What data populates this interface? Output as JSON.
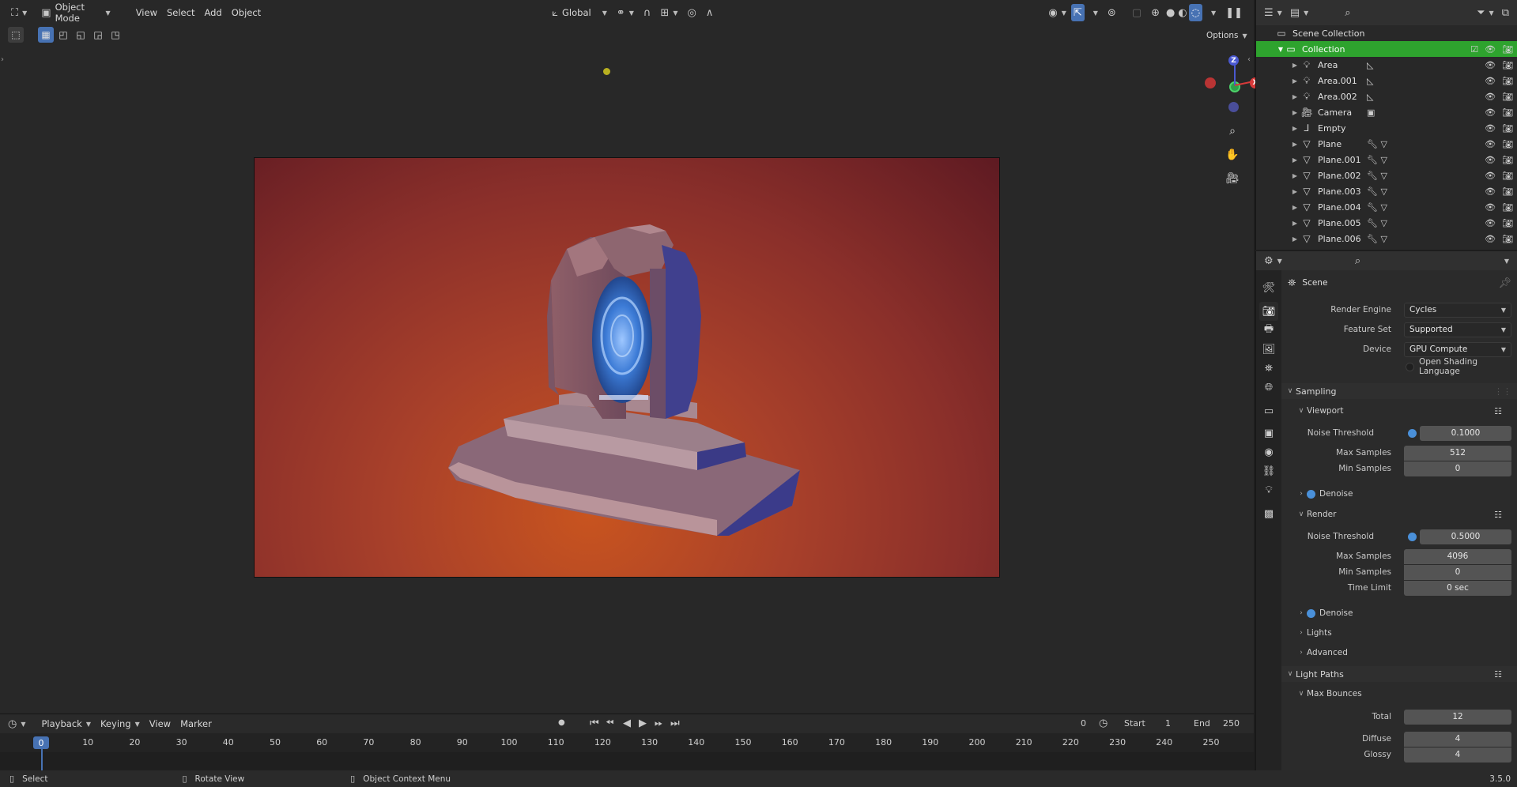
{
  "viewport": {
    "mode_label": "Object Mode",
    "menus": [
      "View",
      "Select",
      "Add",
      "Object"
    ],
    "transform_orientation": "Global",
    "options_label": "Options",
    "gizmo": {
      "z": "Z",
      "x": "X",
      "y": "Y"
    }
  },
  "outliner": {
    "scene_collection": "Scene Collection",
    "collection": "Collection",
    "items": [
      {
        "name": "Area",
        "type": "light"
      },
      {
        "name": "Area.001",
        "type": "light"
      },
      {
        "name": "Area.002",
        "type": "light"
      },
      {
        "name": "Camera",
        "type": "camera"
      },
      {
        "name": "Empty",
        "type": "empty"
      },
      {
        "name": "Plane",
        "type": "mesh"
      },
      {
        "name": "Plane.001",
        "type": "mesh"
      },
      {
        "name": "Plane.002",
        "type": "mesh"
      },
      {
        "name": "Plane.003",
        "type": "mesh"
      },
      {
        "name": "Plane.004",
        "type": "mesh"
      },
      {
        "name": "Plane.005",
        "type": "mesh"
      },
      {
        "name": "Plane.006",
        "type": "mesh"
      }
    ]
  },
  "properties": {
    "context": "Scene",
    "render_engine_label": "Render Engine",
    "render_engine": "Cycles",
    "feature_set_label": "Feature Set",
    "feature_set": "Supported",
    "device_label": "Device",
    "device": "GPU Compute",
    "osl_label": "Open Shading Language",
    "sampling": "Sampling",
    "viewport": "Viewport",
    "vp_noise_label": "Noise Threshold",
    "vp_noise": "0.1000",
    "vp_max_label": "Max Samples",
    "vp_max": "512",
    "vp_min_label": "Min Samples",
    "vp_min": "0",
    "denoise": "Denoise",
    "render": "Render",
    "r_noise_label": "Noise Threshold",
    "r_noise": "0.5000",
    "r_max_label": "Max Samples",
    "r_max": "4096",
    "r_min_label": "Min Samples",
    "r_min": "0",
    "r_time_label": "Time Limit",
    "r_time": "0 sec",
    "denoise2": "Denoise",
    "lights": "Lights",
    "advanced": "Advanced",
    "light_paths": "Light Paths",
    "max_bounces": "Max Bounces",
    "total_label": "Total",
    "total": "12",
    "diffuse_label": "Diffuse",
    "diffuse": "4",
    "glossy_label": "Glossy",
    "glossy": "4"
  },
  "timeline": {
    "menus": [
      "Playback",
      "Keying",
      "View",
      "Marker"
    ],
    "current_frame": "0",
    "start_label": "Start",
    "start": "1",
    "end_label": "End",
    "end": "250",
    "ticks": [
      "0",
      "10",
      "20",
      "30",
      "40",
      "50",
      "60",
      "70",
      "80",
      "90",
      "100",
      "110",
      "120",
      "130",
      "140",
      "150",
      "160",
      "170",
      "180",
      "190",
      "200",
      "210",
      "220",
      "230",
      "240",
      "250"
    ]
  },
  "statusbar": {
    "select": "Select",
    "rotate": "Rotate View",
    "context_menu": "Object Context Menu",
    "version": "3.5.0"
  }
}
